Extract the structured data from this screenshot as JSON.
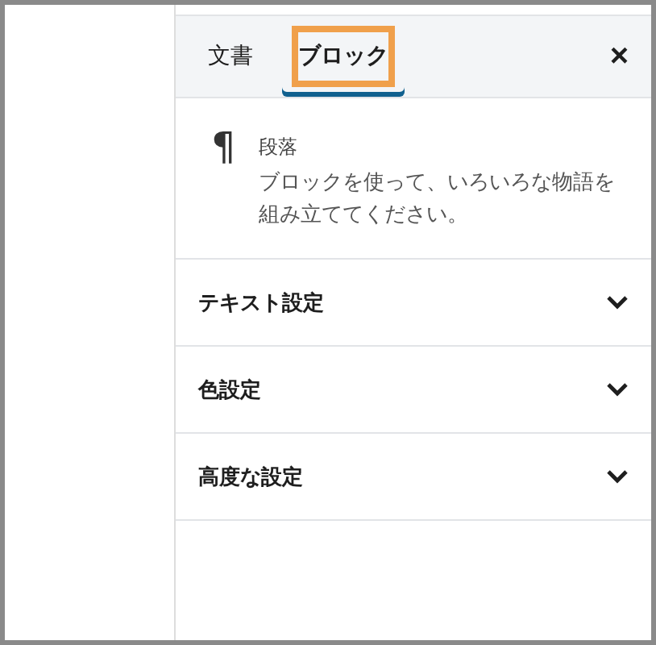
{
  "tabs": [
    {
      "label": "文書",
      "selected": false,
      "highlighted": false
    },
    {
      "label": "ブロック",
      "selected": true,
      "highlighted": true
    }
  ],
  "close_button": {
    "label": "×"
  },
  "block_card": {
    "icon": "¶",
    "title": "段落",
    "description": "ブロックを使って、いろいろな物語を組み立ててください。"
  },
  "panels": [
    {
      "title": "テキスト設定",
      "expanded": false
    },
    {
      "title": "色設定",
      "expanded": false
    },
    {
      "title": "高度な設定",
      "expanded": false
    }
  ]
}
